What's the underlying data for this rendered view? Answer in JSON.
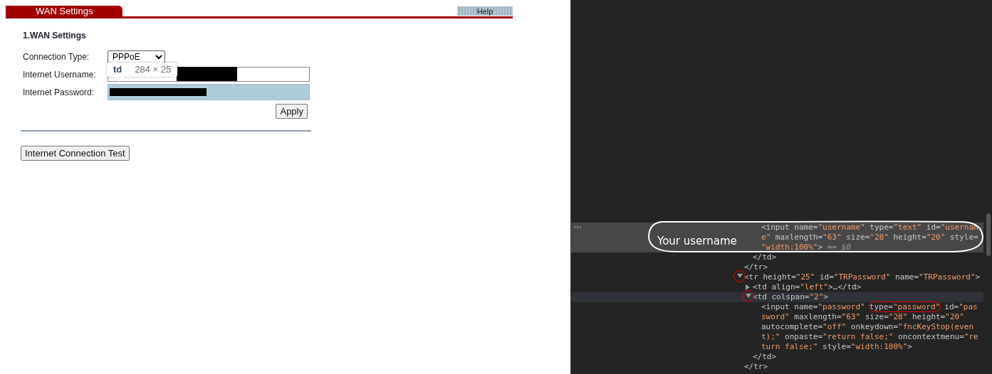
{
  "page": {
    "tab": "WAN Settings",
    "help_button": "Help",
    "section_title": "1.WAN Settings",
    "fields": [
      {
        "kind": "select",
        "label": "Connection Type:",
        "value": "PPPoE"
      },
      {
        "kind": "text",
        "label": "Internet Username:",
        "redacted": true,
        "highlighted": false
      },
      {
        "kind": "password",
        "label": "Internet Password:",
        "redacted": true,
        "highlighted": true
      }
    ],
    "apply_button": "Apply",
    "test_button": "Internet Connection Test",
    "inspect_tooltip": {
      "tag": "td",
      "size": "284 × 25"
    }
  },
  "devtools": {
    "annotation": "Your username",
    "dom_tree": [
      {
        "children": [
          {
            "children": [
              {
                "selected": true,
                "lines": [
                  [
                    {
                      "kind": "markup",
                      "text": "<input name="
                    },
                    {
                      "kind": "value",
                      "text": "\"username\""
                    },
                    {
                      "kind": "markup",
                      "text": " type="
                    },
                    {
                      "kind": "value",
                      "text": "\"text\""
                    },
                    {
                      "kind": "markup",
                      "text": " id="
                    },
                    {
                      "kind": "value",
                      "text": "\"usernam"
                    }
                  ],
                  [
                    {
                      "kind": "value",
                      "text": "e\""
                    },
                    {
                      "kind": "markup",
                      "text": " maxlength="
                    },
                    {
                      "kind": "value",
                      "text": "\"63\""
                    },
                    {
                      "kind": "markup",
                      "text": " size="
                    },
                    {
                      "kind": "value",
                      "text": "\"28\""
                    },
                    {
                      "kind": "markup",
                      "text": " height="
                    },
                    {
                      "kind": "value",
                      "text": "\"20\""
                    },
                    {
                      "kind": "markup",
                      "text": " style="
                    }
                  ],
                  [
                    {
                      "kind": "value",
                      "text": "\"width:100%\""
                    },
                    {
                      "kind": "markup",
                      "text": ">"
                    },
                    {
                      "kind": "note",
                      "text": " == $0"
                    }
                  ]
                ]
              }
            ]
          },
          {
            "lines": [
              [
                {
                  "kind": "markup",
                  "text": "</td>"
                }
              ]
            ]
          }
        ]
      },
      {
        "lines": [
          [
            {
              "kind": "markup",
              "text": "</tr>"
            }
          ]
        ]
      },
      {
        "expanded": true,
        "circled": true,
        "lines": [
          [
            {
              "kind": "markup",
              "text": "<tr height="
            },
            {
              "kind": "value",
              "text": "\"25\""
            },
            {
              "kind": "markup",
              "text": " id="
            },
            {
              "kind": "value",
              "text": "\"TRPassword\""
            },
            {
              "kind": "markup",
              "text": " name="
            },
            {
              "kind": "value",
              "text": "\"TRPassword\""
            },
            {
              "kind": "markup",
              "text": ">"
            }
          ]
        ],
        "children": [
          {
            "expanded": false,
            "circled": false,
            "lines": [
              [
                {
                  "kind": "markup",
                  "text": "<td align="
                },
                {
                  "kind": "value",
                  "text": "\"left\""
                },
                {
                  "kind": "markup",
                  "text": ">…</td>"
                }
              ]
            ]
          },
          {
            "expanded": true,
            "circled": true,
            "hovered": true,
            "lines": [
              [
                {
                  "kind": "markup",
                  "text": "<td colspan="
                },
                {
                  "kind": "value",
                  "text": "\"2\""
                },
                {
                  "kind": "markup",
                  "text": ">"
                }
              ]
            ],
            "children": [
              {
                "lines": [
                  [
                    {
                      "kind": "markup",
                      "text": "<input name="
                    },
                    {
                      "kind": "value",
                      "text": "\"password\" "
                    },
                    {
                      "kind": "markup",
                      "text": "type=",
                      "circled": true
                    },
                    {
                      "kind": "value",
                      "text": "\"password\"",
                      "circled": true
                    },
                    {
                      "kind": "markup",
                      "text": " id="
                    },
                    {
                      "kind": "value",
                      "text": "\"pas"
                    }
                  ],
                  [
                    {
                      "kind": "value",
                      "text": "sword\""
                    },
                    {
                      "kind": "markup",
                      "text": " maxlength="
                    },
                    {
                      "kind": "value",
                      "text": "\"63\""
                    },
                    {
                      "kind": "markup",
                      "text": " size="
                    },
                    {
                      "kind": "value",
                      "text": "\"28\""
                    },
                    {
                      "kind": "markup",
                      "text": " height="
                    },
                    {
                      "kind": "value",
                      "text": "\"20\""
                    }
                  ],
                  [
                    {
                      "kind": "markup",
                      "text": "autocomplete="
                    },
                    {
                      "kind": "value",
                      "text": "\"off\""
                    },
                    {
                      "kind": "markup",
                      "text": " onkeydown="
                    },
                    {
                      "kind": "value",
                      "text": "\"fncKeyStop(even"
                    }
                  ],
                  [
                    {
                      "kind": "value",
                      "text": "t);\""
                    },
                    {
                      "kind": "markup",
                      "text": " onpaste="
                    },
                    {
                      "kind": "value",
                      "text": "\"return false;\""
                    },
                    {
                      "kind": "markup",
                      "text": " oncontextmenu="
                    },
                    {
                      "kind": "value",
                      "text": "\"re"
                    }
                  ],
                  [
                    {
                      "kind": "value",
                      "text": "turn false;\""
                    },
                    {
                      "kind": "markup",
                      "text": " style="
                    },
                    {
                      "kind": "value",
                      "text": "\"width:100%\""
                    },
                    {
                      "kind": "markup",
                      "text": ">"
                    }
                  ]
                ]
              }
            ]
          },
          {
            "lines": [
              [
                {
                  "kind": "markup",
                  "text": "</td>"
                }
              ]
            ]
          }
        ]
      },
      {
        "lines": [
          [
            {
              "kind": "markup",
              "text": "</tr>"
            }
          ]
        ]
      }
    ]
  }
}
